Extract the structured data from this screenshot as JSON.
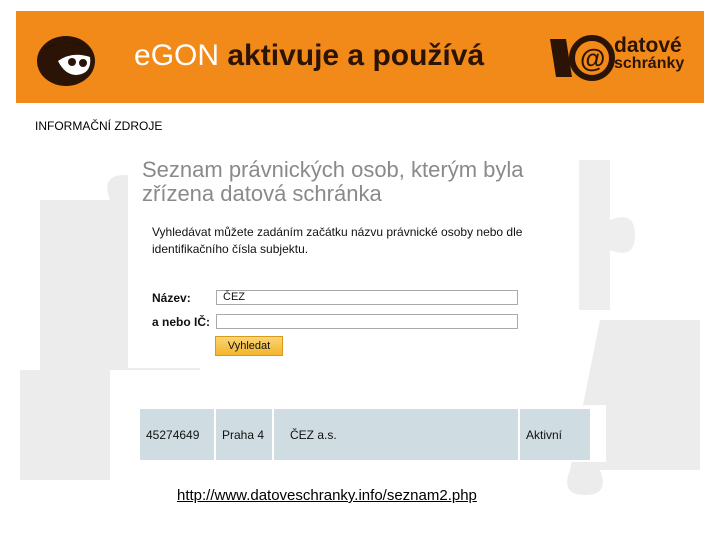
{
  "banner": {
    "brand": "e",
    "brand_name": "GON",
    "headline": "aktivuje a používá",
    "logo_line1": "datové",
    "logo_line2": "schránky",
    "colors": {
      "background": "#f28a1a",
      "dark": "#2b1406"
    },
    "icons": [
      "egon-mascot-icon",
      "datove-schranky-logo-icon"
    ]
  },
  "section_label": "INFORMAČNÍ ZDROJE",
  "panel": {
    "title": "Seznam právnických osob, kterým byla zřízena datová schránka",
    "description": "Vyhledávat můžete zadáním začátku názvu právnické osoby nebo dle identifikačního čísla subjektu.",
    "name_label": "Název:",
    "name_value": "ČEZ",
    "ic_label": "a nebo IČ:",
    "ic_value": "",
    "search_button": "Vyhledat",
    "colors": {
      "title": "#8a8a8a",
      "button": "#f3b52b"
    }
  },
  "result": {
    "columns": [
      "45274649",
      "Praha 4",
      "ČEZ a.s.",
      "Aktivní"
    ],
    "colors": {
      "row": "#cfdde3"
    }
  },
  "link": "http://www.datoveschranky.info/seznam2.php"
}
